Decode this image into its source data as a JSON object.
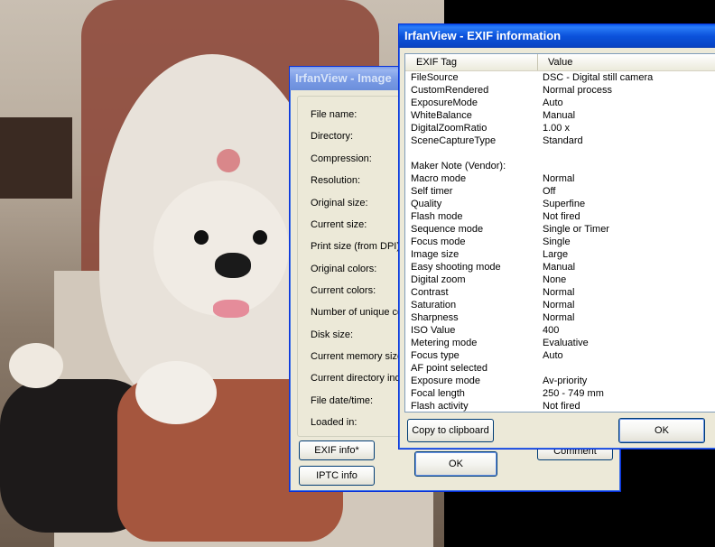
{
  "image_info_window": {
    "title": "IrfanView - Image",
    "fields": [
      "File name:",
      "Directory:",
      "Compression:",
      "Resolution:",
      "Original size:",
      "Current size:",
      "Print size (from DPI):",
      "Original colors:",
      "Current colors:",
      "Number of unique colo",
      "Disk size:",
      "Current memory size:",
      "Current directory index",
      "File date/time:",
      "Loaded in:"
    ],
    "exif_button": "EXIF info*",
    "iptc_button": "IPTC info",
    "ok_button": "OK",
    "comment_button": "Comment"
  },
  "exif_window": {
    "title": "IrfanView - EXIF information",
    "columns": [
      "EXIF Tag",
      "Value"
    ],
    "rows": [
      [
        "FileSource",
        "DSC - Digital still camera"
      ],
      [
        "CustomRendered",
        "Normal process"
      ],
      [
        "ExposureMode",
        "Auto"
      ],
      [
        "WhiteBalance",
        "Manual"
      ],
      [
        "DigitalZoomRatio",
        "1.00 x"
      ],
      [
        "SceneCaptureType",
        "Standard"
      ],
      [
        "",
        ""
      ],
      [
        "Maker Note (Vendor):",
        ""
      ],
      [
        "Macro mode",
        "Normal"
      ],
      [
        "Self timer",
        "Off"
      ],
      [
        "Quality",
        "Superfine"
      ],
      [
        "Flash mode",
        "Not fired"
      ],
      [
        "Sequence mode",
        "Single or Timer"
      ],
      [
        "Focus mode",
        "Single"
      ],
      [
        "Image size",
        "Large"
      ],
      [
        "Easy shooting mode",
        "Manual"
      ],
      [
        "Digital zoom",
        "None"
      ],
      [
        "Contrast",
        "Normal"
      ],
      [
        "Saturation",
        "Normal"
      ],
      [
        "Sharpness",
        "Normal"
      ],
      [
        "ISO Value",
        "400"
      ],
      [
        "Metering mode",
        "Evaluative"
      ],
      [
        "Focus type",
        "Auto"
      ],
      [
        "AF point selected",
        ""
      ],
      [
        "Exposure mode",
        "Av-priority"
      ],
      [
        "Focal length",
        "250 - 749 mm"
      ],
      [
        "Flash activity",
        "Not fired"
      ]
    ],
    "copy_button": "Copy to clipboard",
    "ok_button": "OK"
  }
}
